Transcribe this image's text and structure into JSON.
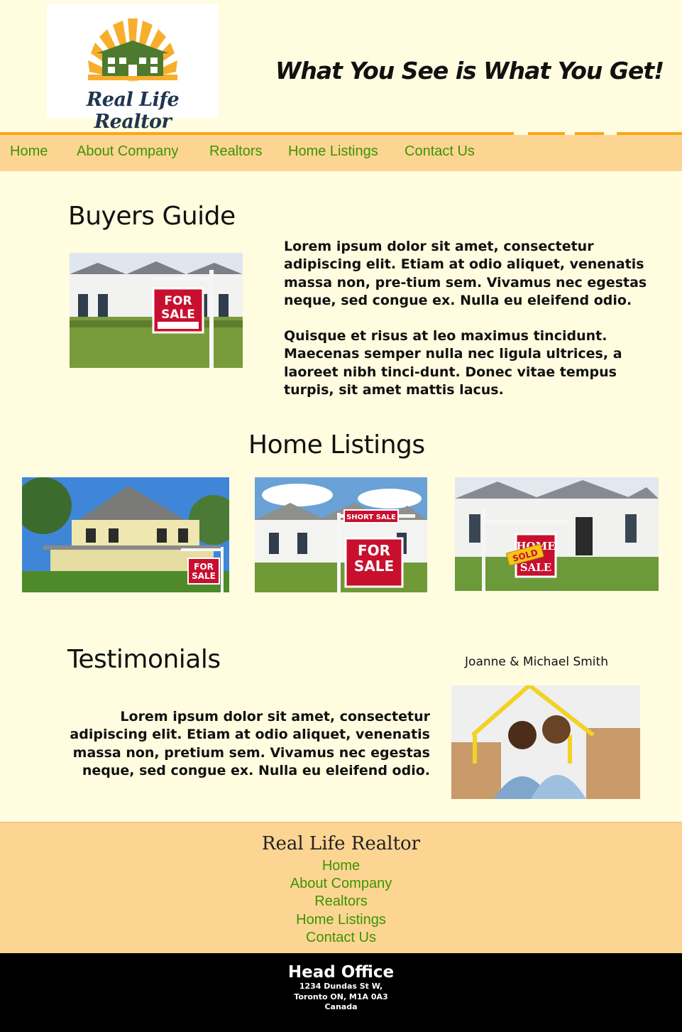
{
  "header": {
    "logo_text": "Real Life Realtor",
    "tagline": "What You See is What You Get!"
  },
  "nav": {
    "items": [
      {
        "label": "Home"
      },
      {
        "label": "About Company"
      },
      {
        "label": "Realtors"
      },
      {
        "label": "Home Listings"
      },
      {
        "label": "Contact Us"
      }
    ]
  },
  "buyers_guide": {
    "title": "Buyers Guide",
    "paragraph1": "Lorem ipsum dolor sit amet, consectetur adipiscing elit. Etiam at odio aliquet, venenatis massa non, pre-tium sem. Vivamus nec egestas neque, sed congue ex. Nulla eu eleifend odio.",
    "paragraph2": "Quisque et risus at leo maximus tincidunt. Maecenas semper nulla nec ligula ultrices, a laoreet nibh tinci-dunt. Donec vitae tempus turpis, sit amet mattis lacus.",
    "sign_line1": "FOR",
    "sign_line2": "SALE"
  },
  "listings": {
    "title": "Home Listings",
    "photo1_sign": [
      "FOR",
      "SALE"
    ],
    "photo2_rider": "SHORT SALE",
    "photo2_sign": [
      "FOR",
      "SALE"
    ],
    "photo3_sign": [
      "HOME",
      "SALE"
    ],
    "photo3_sold": "SOLD"
  },
  "testimonials": {
    "title": "Testimonials",
    "text": "Lorem ipsum dolor sit amet, consectetur adipiscing elit. Etiam at odio aliquet, venenatis massa non, pretium sem. Vivamus nec egestas neque, sed congue ex. Nulla eu eleifend odio.",
    "name": "Joanne & Michael Smith"
  },
  "footer": {
    "title": "Real Life Realtor",
    "links": [
      {
        "label": "Home"
      },
      {
        "label": "About Company"
      },
      {
        "label": "Realtors"
      },
      {
        "label": "Home Listings"
      },
      {
        "label": "Contact Us"
      }
    ]
  },
  "office": {
    "title": "Head Office",
    "address1": "1234 Dundas St W,",
    "address2": "Toronto ON, M1A 0A3",
    "country": "Canada"
  },
  "colors": {
    "page_bg": "#fffce0",
    "nav_bg": "#fdd593",
    "nav_accent": "#f6a81c",
    "link_green": "#3d9400",
    "sign_red": "#c8102e"
  }
}
